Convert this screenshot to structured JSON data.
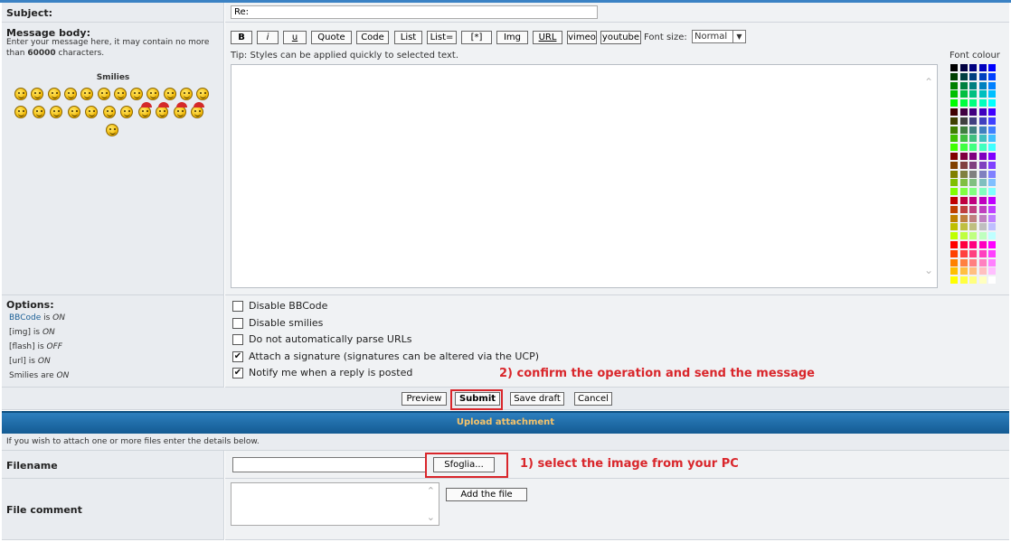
{
  "subject": {
    "label": "Subject:",
    "value": "Re:"
  },
  "message": {
    "label": "Message body:",
    "hint_prefix": "Enter your message here, it may contain no more than ",
    "hint_count": "60000",
    "hint_suffix": " characters.",
    "smilies_title": "Smilies",
    "tip": "Tip: Styles can be applied quickly to selected text."
  },
  "toolbar": {
    "buttons": [
      "B",
      "i",
      "u",
      "Quote",
      "Code",
      "List",
      "List=",
      "[*]",
      "Img",
      "URL",
      "vimeo",
      "youtube"
    ],
    "font_size_label": "Font size:",
    "font_size_value": "Normal",
    "font_colour_label": "Font colour"
  },
  "options": {
    "title": "Options:",
    "status": [
      {
        "name": "BBCode",
        "mid": " is ",
        "state": "ON"
      },
      {
        "name": "[img]",
        "mid": " is ",
        "state": "ON"
      },
      {
        "name": "[flash]",
        "mid": " is ",
        "state": "OFF"
      },
      {
        "name": "[url]",
        "mid": " is ",
        "state": "ON"
      },
      {
        "name": "Smilies",
        "mid": " are ",
        "state": "ON"
      }
    ],
    "checks": [
      {
        "label": "Disable BBCode",
        "checked": false
      },
      {
        "label": "Disable smilies",
        "checked": false
      },
      {
        "label": "Do not automatically parse URLs",
        "checked": false
      },
      {
        "label": "Attach a signature (signatures can be altered via the UCP)",
        "checked": true
      },
      {
        "label": "Notify me when a reply is posted",
        "checked": true
      }
    ]
  },
  "actions": {
    "preview": "Preview",
    "submit": "Submit",
    "save_draft": "Save draft",
    "cancel": "Cancel"
  },
  "upload": {
    "header": "Upload attachment",
    "intro": "If you wish to attach one or more files enter the details below.",
    "filename_label": "Filename",
    "browse": "Sfoglia...",
    "file_comment_label": "File comment",
    "add_file": "Add the file"
  },
  "annotations": {
    "step1": "1) select the image from your PC",
    "step2": "2) confirm the operation and send the message"
  },
  "colors": {
    "accent": "#3b82c4",
    "header_blue": "#1b6aa8",
    "annotation_red": "#d9262b",
    "upload_header_text": "#f7c46a"
  }
}
